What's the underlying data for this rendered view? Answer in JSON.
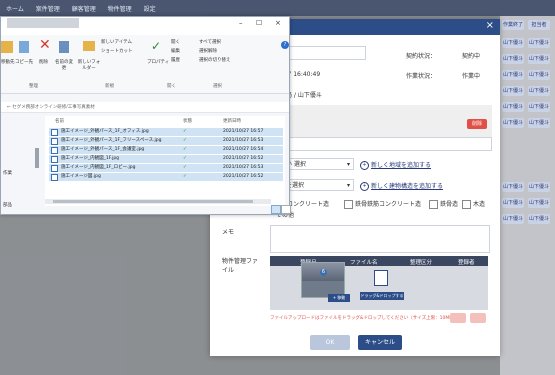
{
  "app": {
    "topbar_items": [
      "ホーム",
      "案件管理",
      "顧客管理",
      "物件管理",
      "設定"
    ]
  },
  "modal": {
    "status_label": "契約状況：",
    "status_value": "契約中",
    "work_status_label": "作業状況：",
    "work_status_value": "作業中",
    "datetime_value": "10/27 16:40:49",
    "person_value": "事務局 / 山下優斗",
    "delete_label": "削除",
    "select1_placeholder": "下さい 選択",
    "add_area_link": "新しく地域を追加する",
    "select2_placeholder": "種別を選択",
    "add_building_link": "新しく建物構造を追加する",
    "structures": [
      "コンクリート造",
      "鉄骨鉄筋コンクリート造",
      "鉄骨造",
      "木造"
    ],
    "other_label": "その他",
    "memo_label": "メモ",
    "file_label": "物件管理ファイル",
    "table_headers": [
      "登録日",
      "ファイル名",
      "整理区分",
      "登録者"
    ],
    "drop_hint": "ドラッグ&ドロップする",
    "copy_label": "+ 移動",
    "upload_note": "ファイルアップロードはファイルをドラッグ&ドロップしてください（サイズ上限：10MB）",
    "ok_label": "OK",
    "cancel_label": "キャンセル",
    "close_icon": "×"
  },
  "explorer": {
    "title": "",
    "address": "← セグメ務部オンライン研修/工事写真素材",
    "ribbon": {
      "clipboard_group": "整理",
      "new_group": "新規",
      "open_group": "開く",
      "select_group": "選択",
      "cut": "移動先",
      "copy": "コピー先",
      "delete": "削除",
      "rename": "名前の変更",
      "new_folder": "新しいフォルダー",
      "new_item": "新しいアイテム",
      "shortcut": "ショートカット",
      "properties": "プロパティ",
      "open": "開く",
      "edit": "編集",
      "history": "履歴",
      "select_all": "すべて選択",
      "select_none": "選択解除",
      "invert": "選択の切り替え"
    },
    "columns": [
      "名前",
      "状態",
      "更新日時"
    ],
    "files": [
      {
        "name": "施工イメージ_外観パース_1F_オフィス.jpg",
        "date": "2021/10/27 16:57"
      },
      {
        "name": "施工イメージ_外観パース_1F_フリースペース.jpg",
        "date": "2021/10/27 16:53"
      },
      {
        "name": "施工イメージ_外観パース_1F_会議室.jpg",
        "date": "2021/10/27 16:54"
      },
      {
        "name": "施工イメージ_内観図_1F.jpg",
        "date": "2021/10/27 16:52"
      },
      {
        "name": "施工イメージ_内観図_1F_ロビー.jpg",
        "date": "2021/10/27 16:53"
      },
      {
        "name": "施工イメージ図.jpg",
        "date": "2021/10/27 16:52"
      }
    ],
    "left_nav": [
      "作業",
      "部品"
    ],
    "sync_icon": "✓",
    "help_badge": "?"
  },
  "background": {
    "right_cells": [
      "作業終了",
      "山下優斗",
      "山下優斗",
      "山下優斗",
      "山下優斗",
      "山下優斗",
      "山下優斗",
      "山下優斗",
      "山下優斗",
      "山下優斗"
    ],
    "right_cells2": [
      "担当者",
      "山下優斗",
      "山下優斗",
      "山下優斗",
      "山下優斗",
      "山下優斗",
      "山下優斗",
      "山下優斗",
      "山下優斗",
      "山下優斗"
    ]
  }
}
